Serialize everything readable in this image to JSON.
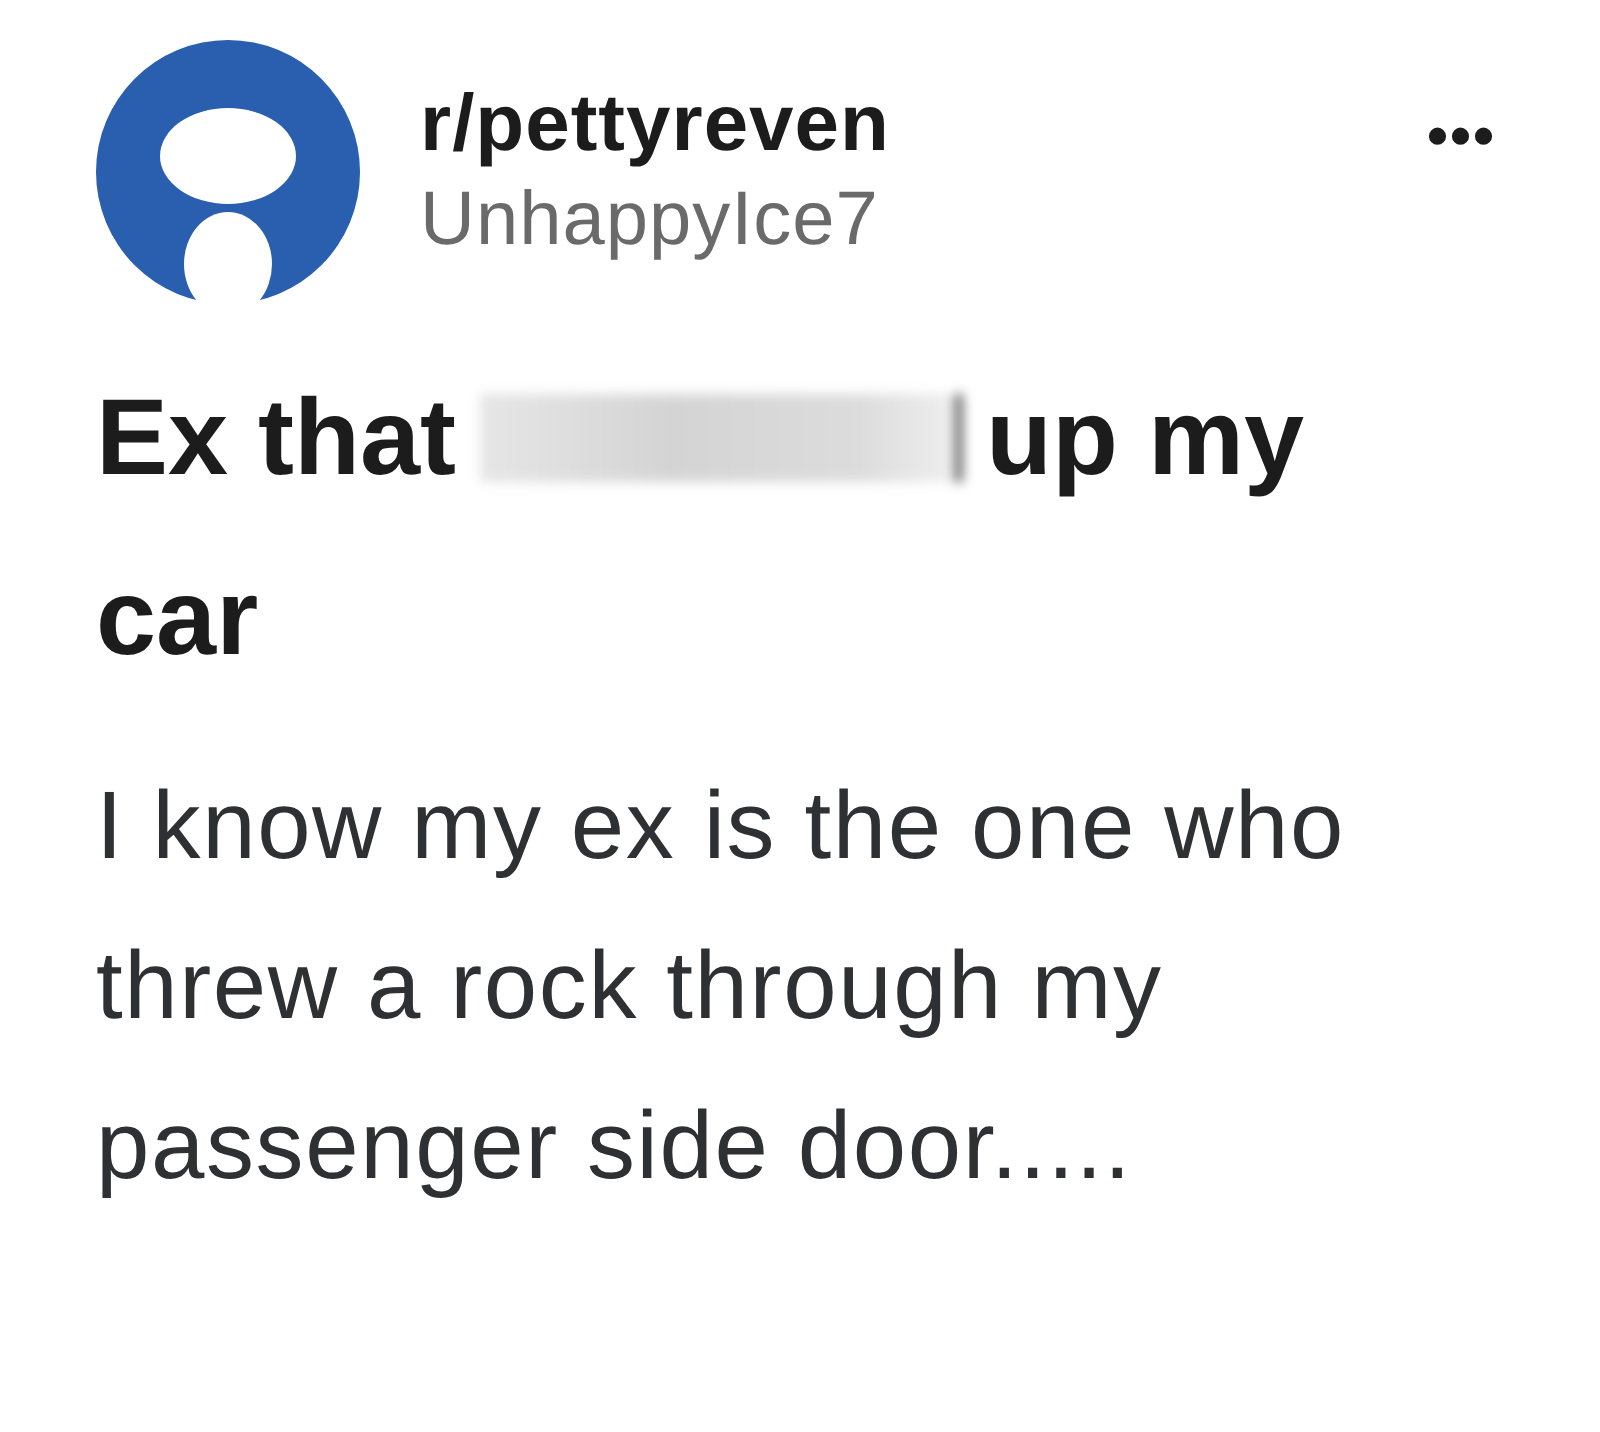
{
  "post": {
    "subreddit": "r/pettyreven",
    "author": "UnhappyIce7",
    "menu": "•••",
    "title_before": "Ex that",
    "title_redacted": true,
    "title_after": "up my car",
    "body": "I know my ex is the one who threw a rock through my passenger side door....."
  }
}
